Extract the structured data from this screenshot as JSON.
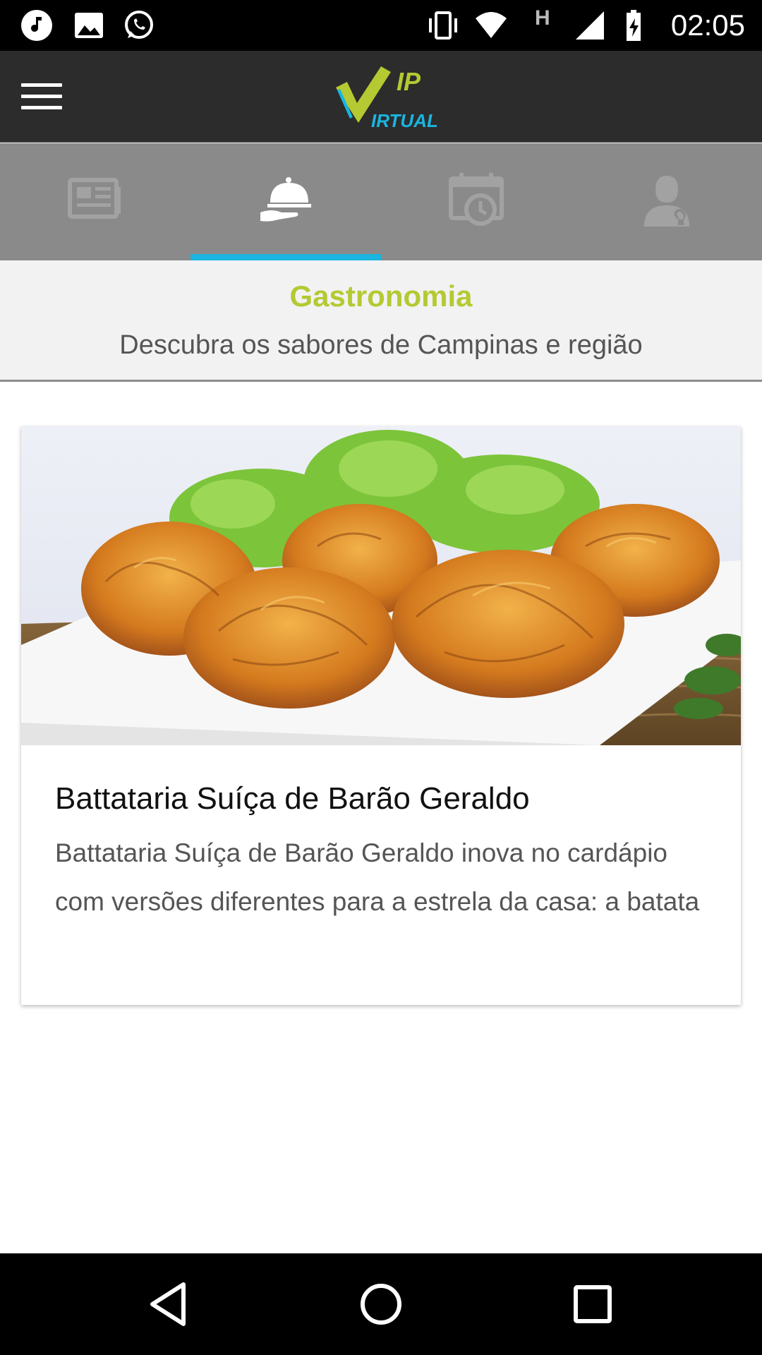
{
  "status_bar": {
    "time": "02:05",
    "left_icons": [
      "music-note-icon",
      "image-icon",
      "whatsapp-icon"
    ],
    "right_icons": [
      "vibrate-icon",
      "wifi-icon",
      "h-network-icon",
      "signal-icon",
      "battery-charging-icon"
    ],
    "network_letter": "H"
  },
  "app_bar": {
    "logo_text_top": "IP",
    "logo_text_bottom": "IRTUAL",
    "logo_colors": {
      "green": "#b5c932",
      "blue": "#1ab5e0"
    }
  },
  "tabs": [
    {
      "icon": "newspaper-icon",
      "selected": false
    },
    {
      "icon": "food-cloche-icon",
      "selected": true
    },
    {
      "icon": "calendar-clock-icon",
      "selected": false
    },
    {
      "icon": "person-icon",
      "selected": false
    }
  ],
  "section": {
    "title": "Gastronomia",
    "subtitle": "Descubra os sabores de Campinas e região"
  },
  "cards": [
    {
      "image": "fried-potato-dumplings-photo",
      "title": "Battataria Suíça de Barão Geraldo",
      "description": "Battataria Suíça de Barão Geraldo inova no cardápio com versões diferentes para a estrela da casa: a batata"
    }
  ],
  "nav_bar": {
    "buttons": [
      "back-icon",
      "home-icon",
      "recents-icon"
    ]
  },
  "colors": {
    "accent": "#1ab5e0",
    "title_green": "#b5c932",
    "app_bar": "#2c2c2c",
    "tab_bar": "#8a8a8a"
  }
}
